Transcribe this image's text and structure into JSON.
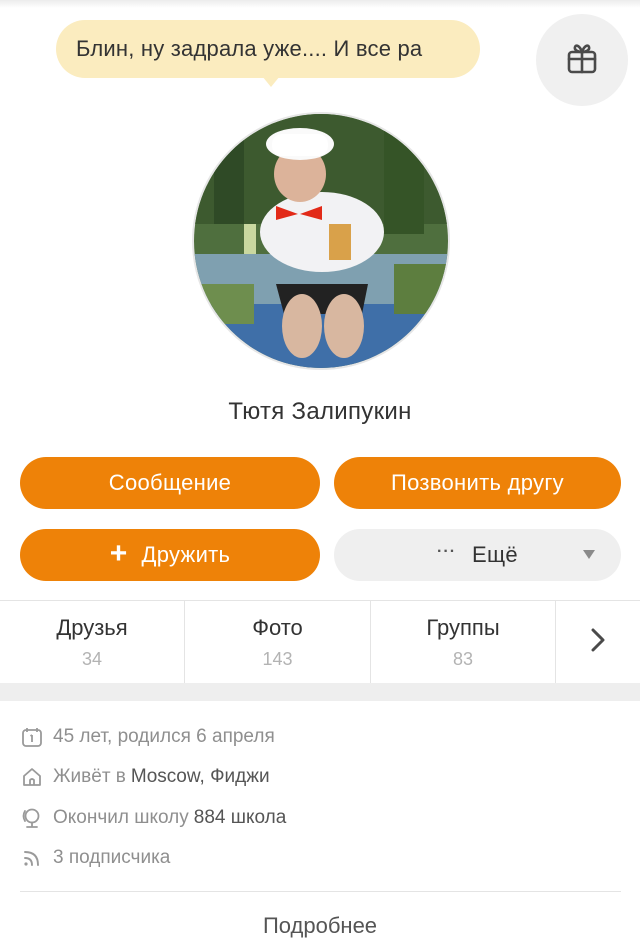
{
  "status_text": "Блин, ну задрала уже.... И все ра",
  "profile": {
    "name": "Тютя Залипукин"
  },
  "buttons": {
    "message": "Сообщение",
    "call": "Позвонить другу",
    "add_friend_icon": "+",
    "add_friend": "Дружить",
    "more_icon": "···",
    "more": "Ещё"
  },
  "tabs": [
    {
      "label": "Друзья",
      "count": "34"
    },
    {
      "label": "Фото",
      "count": "143"
    },
    {
      "label": "Группы",
      "count": "83"
    }
  ],
  "info": {
    "age": "45 лет, родился 6 апреля",
    "city_prefix": "Живёт в",
    "city": "Moscow, Фиджи",
    "school_prefix": "Окончил школу",
    "school": "884 школа",
    "subscribers": "3 подписчика"
  },
  "more_details": "Подробнее",
  "icons": [
    "gift-icon",
    "plus-icon",
    "more-dots-icon",
    "dropdown-triangle-icon",
    "chevron-right-icon",
    "calendar-icon",
    "home-icon",
    "school-icon",
    "rss-icon"
  ],
  "colors": {
    "accent": "#ee8208",
    "bubble": "#fbecbf"
  }
}
